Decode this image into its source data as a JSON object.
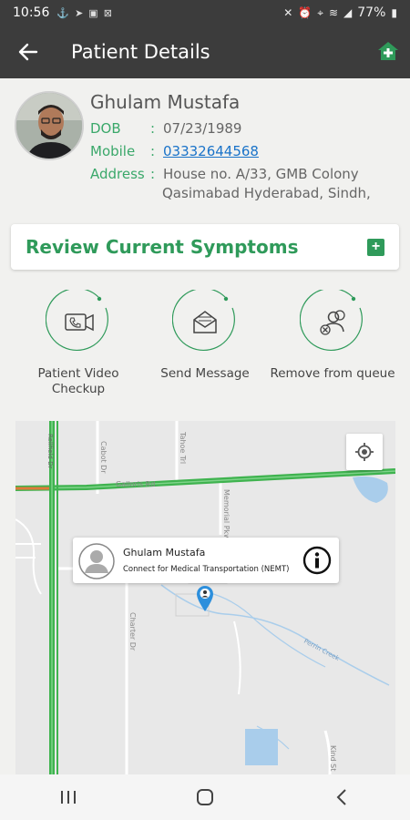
{
  "status_bar": {
    "time": "10:56",
    "battery": "77%",
    "left_icons": [
      "usb-icon",
      "send-icon",
      "image-icon",
      "box-icon"
    ],
    "right_icons": [
      "mute-icon",
      "alarm-icon",
      "location-icon",
      "wifi-icon",
      "signal-icon",
      "battery-icon"
    ]
  },
  "app_bar": {
    "title": "Patient Details",
    "back_icon": "back-arrow-icon",
    "action_icon": "home-plus-icon"
  },
  "patient": {
    "name": "Ghulam Mustafa",
    "dob_label": "DOB",
    "dob_value": "07/23/1989",
    "mobile_label": "Mobile",
    "mobile_value": "03332644568",
    "address_label": "Address",
    "address_line1": "House no. A/33, GMB Colony",
    "address_line2": "Qasimabad Hyderabad, Sindh,",
    "colon": ":"
  },
  "symptoms_card": {
    "title": "Review Current Symptoms",
    "action_icon": "add-icon"
  },
  "actions": [
    {
      "label_line1": "Patient Video",
      "label_line2": "Checkup",
      "icon": "video-call-icon"
    },
    {
      "label_line1": "Send Message",
      "label_line2": "",
      "icon": "mail-icon"
    },
    {
      "label_line1": "Remove from queue",
      "label_line2": "",
      "icon": "remove-user-icon"
    }
  ],
  "map": {
    "info_name": "Ghulam Mustafa",
    "info_subtitle": "Connect for Medical Transportation (NEMT)",
    "street_labels": [
      "Cabot Dr",
      "Tahoe Trl",
      "Galloris Rd",
      "Memorial Pkwy",
      "Charter Dr",
      "Perrin Creek",
      "Rellfield Dr",
      "Kind St"
    ],
    "colors": {
      "traffic_green": "#3fb34f",
      "traffic_orange": "#e07a3a",
      "water": "#a9cdeb",
      "road": "#ffffff",
      "land": "#e8e8e8"
    }
  },
  "nav_bar": {
    "recents_icon": "recents-icon",
    "home_icon": "home-icon",
    "back_icon": "back-icon"
  },
  "colors": {
    "app_bar": "#3c3c3c",
    "accent_green": "#2f9a5a",
    "label_green": "#3aa86a",
    "link_blue": "#1a73c9"
  }
}
